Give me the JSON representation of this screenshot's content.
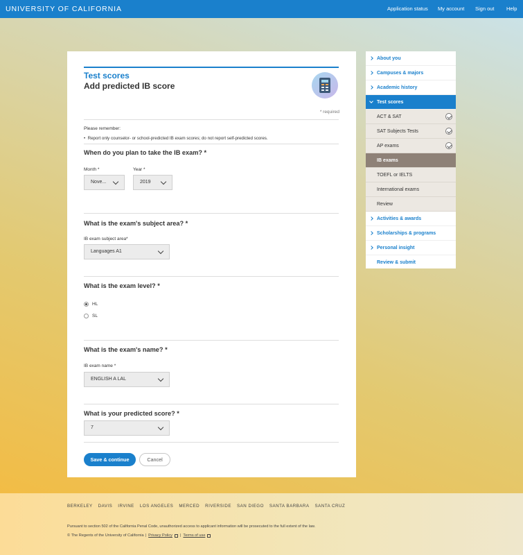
{
  "header": {
    "brand": "UNIVERSITY OF CALIFORNIA",
    "nav": [
      "Application status",
      "My account",
      "Sign out",
      "Help"
    ]
  },
  "card": {
    "section": "Test scores",
    "title": "Add predicted IB score",
    "required_note": "* required",
    "remember_heading": "Please remember:",
    "remember_items": [
      "Report only counselor- or school-predicted IB exam scores; do not report self-predicted scores."
    ],
    "q_when": "When do you plan to take the IB exam? *",
    "month_label": "Month *",
    "month_value": "Nove...",
    "year_label": "Year *",
    "year_value": "2019",
    "q_subject": "What is the exam's subject area? *",
    "subject_label": "IB exam subject area*",
    "subject_value": "Languages A1",
    "q_level": "What is the exam level? *",
    "level_options": [
      "HL",
      "SL"
    ],
    "level_selected": "HL",
    "q_name": "What is the exam's name? *",
    "name_label": "IB exam name *",
    "name_value": "ENGLISH A LAL",
    "q_score": "What is your predicted score? *",
    "score_value": "7",
    "save_label": "Save & continue",
    "cancel_label": "Cancel"
  },
  "sidebar": {
    "items": [
      {
        "label": "About you"
      },
      {
        "label": "Campuses & majors"
      },
      {
        "label": "Academic history"
      },
      {
        "label": "Test scores"
      }
    ],
    "subitems": [
      {
        "label": "ACT & SAT",
        "complete": true
      },
      {
        "label": "SAT Subjects Tests",
        "complete": true
      },
      {
        "label": "AP exams",
        "complete": true
      },
      {
        "label": "IB exams",
        "complete": false
      },
      {
        "label": "TOEFL or IELTS",
        "complete": false
      },
      {
        "label": "International exams",
        "complete": false
      },
      {
        "label": "Review",
        "complete": false
      }
    ],
    "items_after": [
      {
        "label": "Activities & awards"
      },
      {
        "label": "Scholarships & programs"
      },
      {
        "label": "Personal insight"
      },
      {
        "label": "Review & submit"
      }
    ]
  },
  "footer": {
    "campuses": [
      "BERKELEY",
      "DAVIS",
      "IRVINE",
      "LOS ANGELES",
      "MERCED",
      "RIVERSIDE",
      "SAN DIEGO",
      "SANTA BARBARA",
      "SANTA CRUZ"
    ],
    "legal": "Pursuant to section 502 of the California Penal Code, unauthorized access to applicant information will be prosecuted to the full extent of the law.",
    "copyright": "© The Regents of the University of California",
    "privacy": "Privacy Policy",
    "terms": "Terms of use"
  }
}
